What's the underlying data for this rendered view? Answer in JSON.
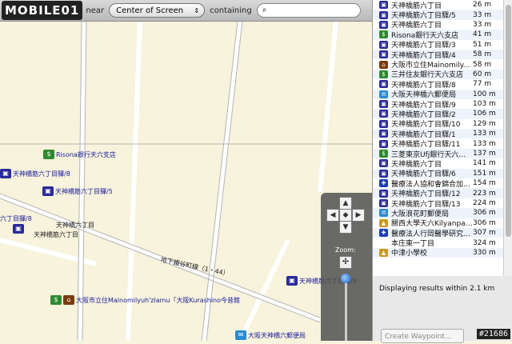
{
  "toolbar": {
    "logo": "MOBILE01",
    "near_label": "near",
    "near_value": "Center of Screen",
    "containing_label": "containing",
    "search_placeholder": ""
  },
  "map": {
    "road_labels": [
      "天神橋六丁目",
      "天神橋筋六丁目",
      "地下鐵谷町線（1・44）"
    ],
    "pois": [
      {
        "label": "Risona銀行天六支店",
        "type": "bank"
      },
      {
        "label": "天神橋筋六丁目驛/8",
        "type": "bus"
      },
      {
        "label": "天神橋筋六丁目驛/5",
        "type": "bus"
      },
      {
        "label": "六丁目驛/8",
        "type": "bus"
      },
      {
        "label": "大阪市立住Mainomilyuh'zlamu「大阪Kurashino今昔館",
        "type": "museum"
      },
      {
        "label": "天神橋筋六丁目驛/9",
        "type": "bus"
      },
      {
        "label": "大阪天神橋六郵便局",
        "type": "post"
      }
    ],
    "zoom_label": "Zoom:"
  },
  "results": [
    {
      "name": "天神橋筋六丁目",
      "dist": "26 m",
      "type": "bus"
    },
    {
      "name": "天神橋筋六丁目驛/5",
      "dist": "33 m",
      "type": "bus"
    },
    {
      "name": "天神橋筋六丁目",
      "dist": "33 m",
      "type": "bus"
    },
    {
      "name": "Risona銀行天六支店",
      "dist": "41 m",
      "type": "bank"
    },
    {
      "name": "天神橋筋六丁目驛/3",
      "dist": "51 m",
      "type": "bus"
    },
    {
      "name": "天神橋筋六丁目驛/4",
      "dist": "58 m",
      "type": "bus"
    },
    {
      "name": "大阪市立住Mainomily...",
      "dist": "58 m",
      "type": "museum"
    },
    {
      "name": "三井住友銀行天六支店",
      "dist": "60 m",
      "type": "bank"
    },
    {
      "name": "天神橋筋六丁目驛/8",
      "dist": "77 m",
      "type": "bus"
    },
    {
      "name": "大阪天神橋六郵便局",
      "dist": "100 m",
      "type": "post"
    },
    {
      "name": "天神橋筋六丁目驛/9",
      "dist": "103 m",
      "type": "bus"
    },
    {
      "name": "天神橋筋六丁目驛/2",
      "dist": "106 m",
      "type": "bus"
    },
    {
      "name": "天神橋筋六丁目驛/10",
      "dist": "129 m",
      "type": "bus"
    },
    {
      "name": "天神橋筋六丁目驛/1",
      "dist": "133 m",
      "type": "bus"
    },
    {
      "name": "天神橋筋六丁目驛/11",
      "dist": "133 m",
      "type": "bus"
    },
    {
      "name": "三菱東京Ufj銀行天六支店",
      "dist": "137 m",
      "type": "bank"
    },
    {
      "name": "天神橋筋六丁目",
      "dist": "141 m",
      "type": "bus"
    },
    {
      "name": "天神橋筋六丁目驛/6",
      "dist": "151 m",
      "type": "bus"
    },
    {
      "name": "醫療法人協和會錦合加...",
      "dist": "154 m",
      "type": "hospital"
    },
    {
      "name": "天神橋筋六丁目驛/12",
      "dist": "223 m",
      "type": "bus"
    },
    {
      "name": "天神橋筋六丁目驛/13",
      "dist": "224 m",
      "type": "bus"
    },
    {
      "name": "大阪浪花町郵便局",
      "dist": "306 m",
      "type": "post"
    },
    {
      "name": "關西大學天六Kilyanpasu",
      "dist": "306 m",
      "type": "school"
    },
    {
      "name": "醫療法人行岡醫學研究...",
      "dist": "307 m",
      "type": "hospital"
    },
    {
      "name": "本庄東一丁目",
      "dist": "324 m",
      "type": "none"
    },
    {
      "name": "中津小學校",
      "dist": "330 m",
      "type": "school"
    }
  ],
  "status": "Displaying results within 2.1 km",
  "create_waypoint": "Create Waypoint...",
  "corner_tag": "#21686"
}
